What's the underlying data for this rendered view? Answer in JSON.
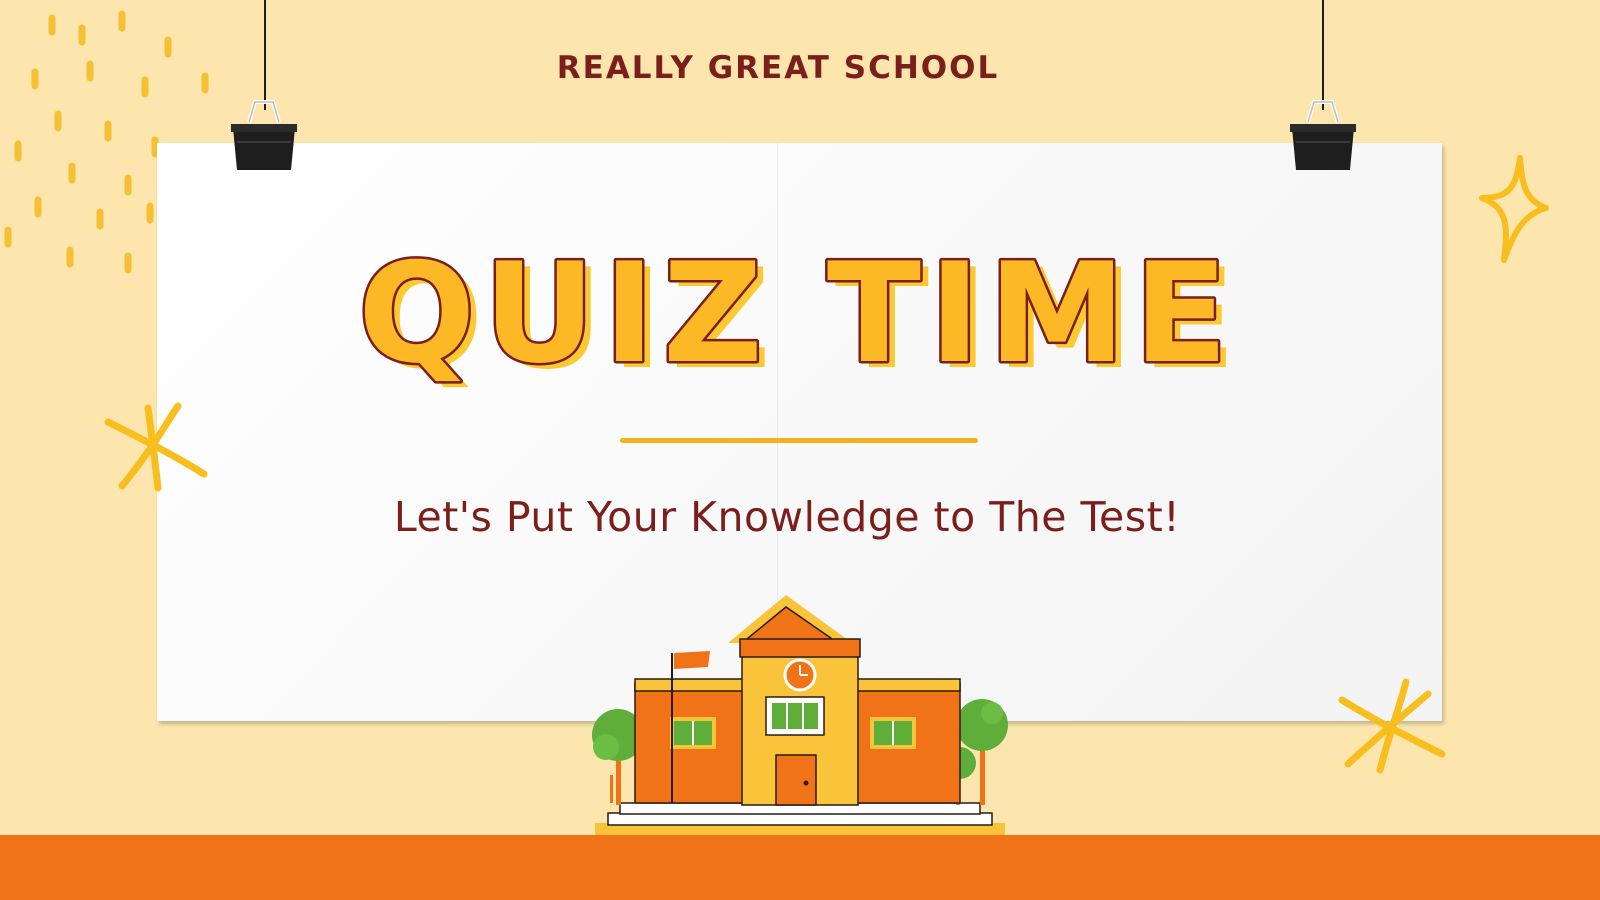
{
  "school": {
    "name": "REALLY GREAT SCHOOL"
  },
  "poster": {
    "headline": "QUIZ TIME",
    "tagline": "Let's Put Your Knowledge to The Test!"
  },
  "colors": {
    "background": "#FDE6AE",
    "paper": "#FFFFFF",
    "headline_fill": "#FCB825",
    "headline_outline": "#7A1F1B",
    "text_dark_red": "#7A1F1B",
    "accent_yellow": "#F7BE1E",
    "ground_orange": "#F07318"
  },
  "icons": {
    "binder_clip": "binder-clip-icon",
    "sparkle": "sparkle-star-icon",
    "asterisk": "asterisk-doodle-icon",
    "school": "school-building-illustration"
  }
}
